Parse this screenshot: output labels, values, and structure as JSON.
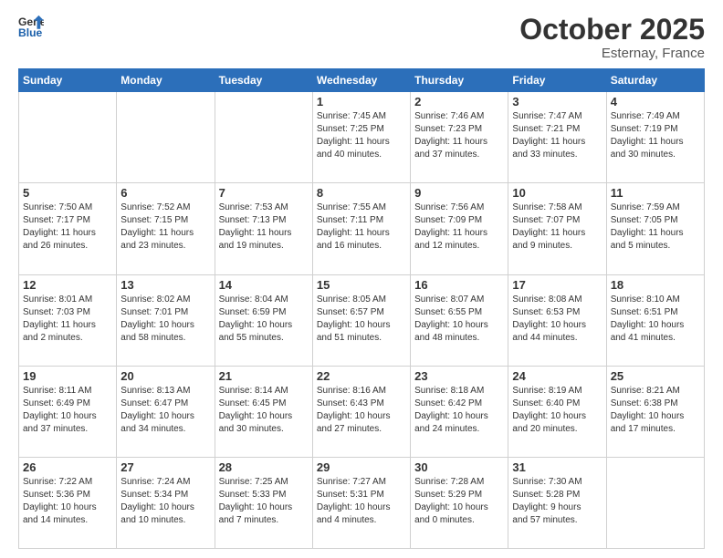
{
  "header": {
    "logo_general": "General",
    "logo_blue": "Blue",
    "month": "October 2025",
    "location": "Esternay, France"
  },
  "days_of_week": [
    "Sunday",
    "Monday",
    "Tuesday",
    "Wednesday",
    "Thursday",
    "Friday",
    "Saturday"
  ],
  "weeks": [
    [
      {
        "day": "",
        "info": ""
      },
      {
        "day": "",
        "info": ""
      },
      {
        "day": "",
        "info": ""
      },
      {
        "day": "1",
        "info": "Sunrise: 7:45 AM\nSunset: 7:25 PM\nDaylight: 11 hours\nand 40 minutes."
      },
      {
        "day": "2",
        "info": "Sunrise: 7:46 AM\nSunset: 7:23 PM\nDaylight: 11 hours\nand 37 minutes."
      },
      {
        "day": "3",
        "info": "Sunrise: 7:47 AM\nSunset: 7:21 PM\nDaylight: 11 hours\nand 33 minutes."
      },
      {
        "day": "4",
        "info": "Sunrise: 7:49 AM\nSunset: 7:19 PM\nDaylight: 11 hours\nand 30 minutes."
      }
    ],
    [
      {
        "day": "5",
        "info": "Sunrise: 7:50 AM\nSunset: 7:17 PM\nDaylight: 11 hours\nand 26 minutes."
      },
      {
        "day": "6",
        "info": "Sunrise: 7:52 AM\nSunset: 7:15 PM\nDaylight: 11 hours\nand 23 minutes."
      },
      {
        "day": "7",
        "info": "Sunrise: 7:53 AM\nSunset: 7:13 PM\nDaylight: 11 hours\nand 19 minutes."
      },
      {
        "day": "8",
        "info": "Sunrise: 7:55 AM\nSunset: 7:11 PM\nDaylight: 11 hours\nand 16 minutes."
      },
      {
        "day": "9",
        "info": "Sunrise: 7:56 AM\nSunset: 7:09 PM\nDaylight: 11 hours\nand 12 minutes."
      },
      {
        "day": "10",
        "info": "Sunrise: 7:58 AM\nSunset: 7:07 PM\nDaylight: 11 hours\nand 9 minutes."
      },
      {
        "day": "11",
        "info": "Sunrise: 7:59 AM\nSunset: 7:05 PM\nDaylight: 11 hours\nand 5 minutes."
      }
    ],
    [
      {
        "day": "12",
        "info": "Sunrise: 8:01 AM\nSunset: 7:03 PM\nDaylight: 11 hours\nand 2 minutes."
      },
      {
        "day": "13",
        "info": "Sunrise: 8:02 AM\nSunset: 7:01 PM\nDaylight: 10 hours\nand 58 minutes."
      },
      {
        "day": "14",
        "info": "Sunrise: 8:04 AM\nSunset: 6:59 PM\nDaylight: 10 hours\nand 55 minutes."
      },
      {
        "day": "15",
        "info": "Sunrise: 8:05 AM\nSunset: 6:57 PM\nDaylight: 10 hours\nand 51 minutes."
      },
      {
        "day": "16",
        "info": "Sunrise: 8:07 AM\nSunset: 6:55 PM\nDaylight: 10 hours\nand 48 minutes."
      },
      {
        "day": "17",
        "info": "Sunrise: 8:08 AM\nSunset: 6:53 PM\nDaylight: 10 hours\nand 44 minutes."
      },
      {
        "day": "18",
        "info": "Sunrise: 8:10 AM\nSunset: 6:51 PM\nDaylight: 10 hours\nand 41 minutes."
      }
    ],
    [
      {
        "day": "19",
        "info": "Sunrise: 8:11 AM\nSunset: 6:49 PM\nDaylight: 10 hours\nand 37 minutes."
      },
      {
        "day": "20",
        "info": "Sunrise: 8:13 AM\nSunset: 6:47 PM\nDaylight: 10 hours\nand 34 minutes."
      },
      {
        "day": "21",
        "info": "Sunrise: 8:14 AM\nSunset: 6:45 PM\nDaylight: 10 hours\nand 30 minutes."
      },
      {
        "day": "22",
        "info": "Sunrise: 8:16 AM\nSunset: 6:43 PM\nDaylight: 10 hours\nand 27 minutes."
      },
      {
        "day": "23",
        "info": "Sunrise: 8:18 AM\nSunset: 6:42 PM\nDaylight: 10 hours\nand 24 minutes."
      },
      {
        "day": "24",
        "info": "Sunrise: 8:19 AM\nSunset: 6:40 PM\nDaylight: 10 hours\nand 20 minutes."
      },
      {
        "day": "25",
        "info": "Sunrise: 8:21 AM\nSunset: 6:38 PM\nDaylight: 10 hours\nand 17 minutes."
      }
    ],
    [
      {
        "day": "26",
        "info": "Sunrise: 7:22 AM\nSunset: 5:36 PM\nDaylight: 10 hours\nand 14 minutes."
      },
      {
        "day": "27",
        "info": "Sunrise: 7:24 AM\nSunset: 5:34 PM\nDaylight: 10 hours\nand 10 minutes."
      },
      {
        "day": "28",
        "info": "Sunrise: 7:25 AM\nSunset: 5:33 PM\nDaylight: 10 hours\nand 7 minutes."
      },
      {
        "day": "29",
        "info": "Sunrise: 7:27 AM\nSunset: 5:31 PM\nDaylight: 10 hours\nand 4 minutes."
      },
      {
        "day": "30",
        "info": "Sunrise: 7:28 AM\nSunset: 5:29 PM\nDaylight: 10 hours\nand 0 minutes."
      },
      {
        "day": "31",
        "info": "Sunrise: 7:30 AM\nSunset: 5:28 PM\nDaylight: 9 hours\nand 57 minutes."
      },
      {
        "day": "",
        "info": ""
      }
    ]
  ]
}
